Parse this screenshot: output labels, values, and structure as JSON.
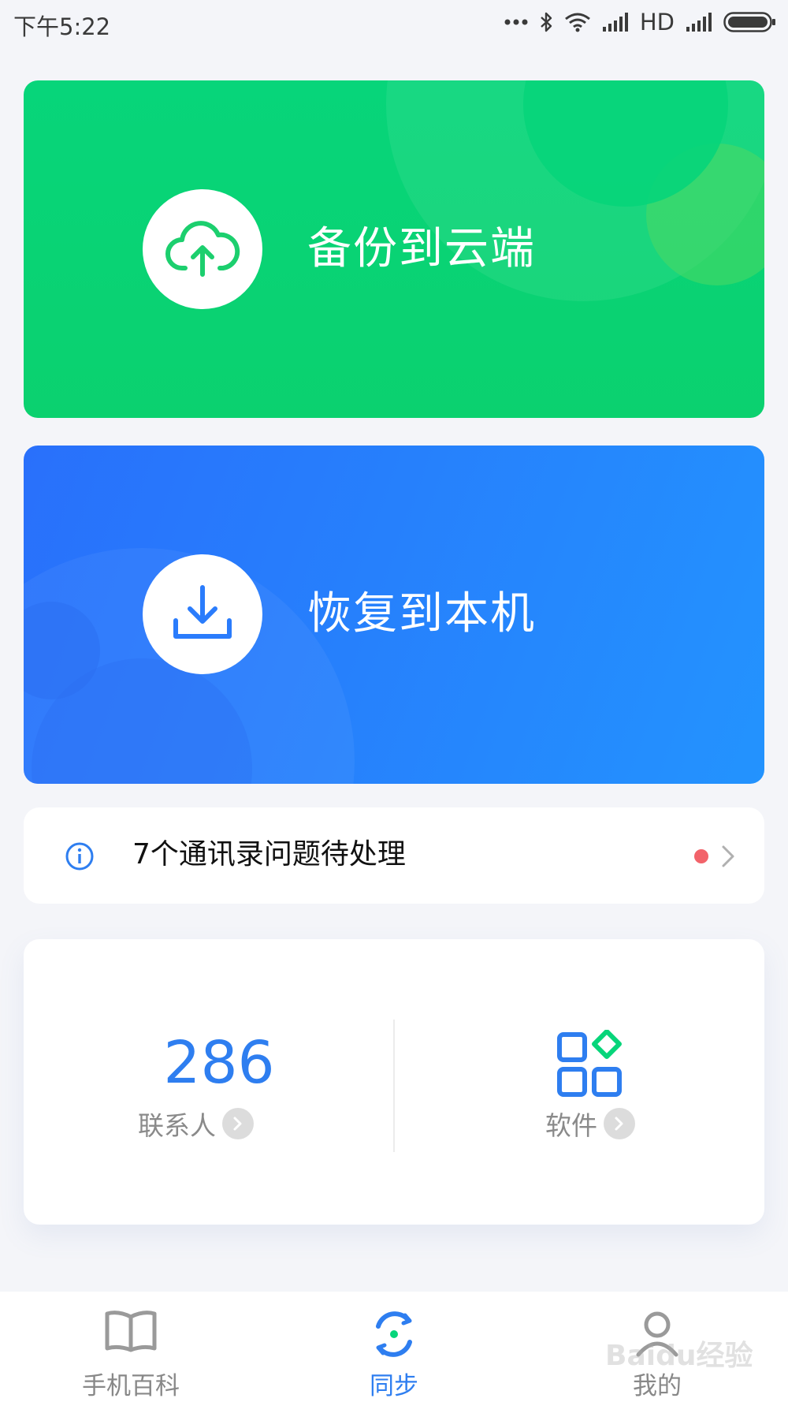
{
  "status_bar": {
    "time": "下午5:22",
    "network_label": "HD"
  },
  "backup_card": {
    "label": "备份到云端",
    "icon": "cloud-upload-icon",
    "color": "#07d57a"
  },
  "restore_card": {
    "label": "恢复到本机",
    "icon": "download-icon",
    "color": "#2a7cfc"
  },
  "issue_bar": {
    "text": "7个通讯录问题待处理",
    "icon": "info-icon",
    "badge_color": "#f2636a"
  },
  "stats": {
    "contacts_count": "286",
    "contacts_label": "联系人",
    "apps_label": "软件",
    "accent": "#2e7ef0"
  },
  "tab_bar": {
    "tabs": [
      {
        "label": "手机百科",
        "icon": "book-icon",
        "active": false
      },
      {
        "label": "同步",
        "icon": "sync-icon",
        "active": true
      },
      {
        "label": "我的",
        "icon": "person-icon",
        "active": false
      }
    ]
  },
  "watermark": "Baidu经验"
}
